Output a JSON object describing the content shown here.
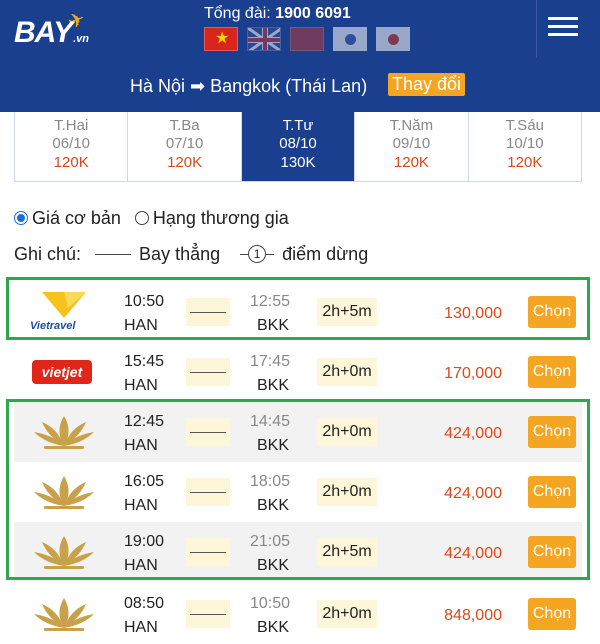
{
  "header": {
    "logo_main": "BAY",
    "logo_suffix": ".vn",
    "hotline_label": "Tổng đài:",
    "hotline_number": "1900 6091",
    "flags": [
      "vietnam-flag-icon",
      "uk-flag-icon",
      "china-flag-icon",
      "korea-flag-icon",
      "japan-flag-icon"
    ]
  },
  "route": {
    "text": "Hà Nội ➡ Bangkok (Thái Lan)",
    "change_label": "Thay đổi"
  },
  "dates": [
    {
      "dow": "T.Hai",
      "day": "06/10",
      "price": "120K",
      "active": false
    },
    {
      "dow": "T.Ba",
      "day": "07/10",
      "price": "120K",
      "active": false
    },
    {
      "dow": "T.Tư",
      "day": "08/10",
      "price": "130K",
      "active": true
    },
    {
      "dow": "T.Năm",
      "day": "09/10",
      "price": "120K",
      "active": false
    },
    {
      "dow": "T.Sáu",
      "day": "10/10",
      "price": "120K",
      "active": false
    }
  ],
  "options": {
    "basic_label": "Giá cơ bản",
    "business_label": "Hạng thương gia",
    "selected": "basic"
  },
  "legend": {
    "note_label": "Ghi chú:",
    "direct_label": "Bay thẳng",
    "stop_number": "1",
    "stop_label": "điểm dừng"
  },
  "flights": [
    {
      "airline": "vietravel-logo",
      "airline_text": "Vietravel",
      "dep_time": "10:50",
      "dep_code": "HAN",
      "arr_time": "12:55",
      "arr_code": "BKK",
      "duration": "2h+5m",
      "price": "130,000",
      "select_label": "Chọn"
    },
    {
      "airline": "vietjet-logo",
      "airline_text": "vietjet",
      "dep_time": "15:45",
      "dep_code": "HAN",
      "arr_time": "17:45",
      "arr_code": "BKK",
      "duration": "2h+0m",
      "price": "170,000",
      "select_label": "Chọn"
    },
    {
      "airline": "vietnam-airlines-lotus-logo",
      "dep_time": "12:45",
      "dep_code": "HAN",
      "arr_time": "14:45",
      "arr_code": "BKK",
      "duration": "2h+0m",
      "price": "424,000",
      "select_label": "Chọn"
    },
    {
      "airline": "vietnam-airlines-lotus-logo",
      "dep_time": "16:05",
      "dep_code": "HAN",
      "arr_time": "18:05",
      "arr_code": "BKK",
      "duration": "2h+0m",
      "price": "424,000",
      "select_label": "Chọn"
    },
    {
      "airline": "vietnam-airlines-lotus-logo",
      "dep_time": "19:00",
      "dep_code": "HAN",
      "arr_time": "21:05",
      "arr_code": "BKK",
      "duration": "2h+5m",
      "price": "424,000",
      "select_label": "Chọn"
    },
    {
      "airline": "vietnam-airlines-lotus-logo",
      "dep_time": "08:50",
      "dep_code": "HAN",
      "arr_time": "10:50",
      "arr_code": "BKK",
      "duration": "2h+0m",
      "price": "848,000",
      "select_label": "Chọn"
    }
  ],
  "colors": {
    "header_bg": "#1a3f8f",
    "accent_orange": "#f4a521",
    "price_red": "#d9481a",
    "highlight_green": "#2ea84f"
  }
}
